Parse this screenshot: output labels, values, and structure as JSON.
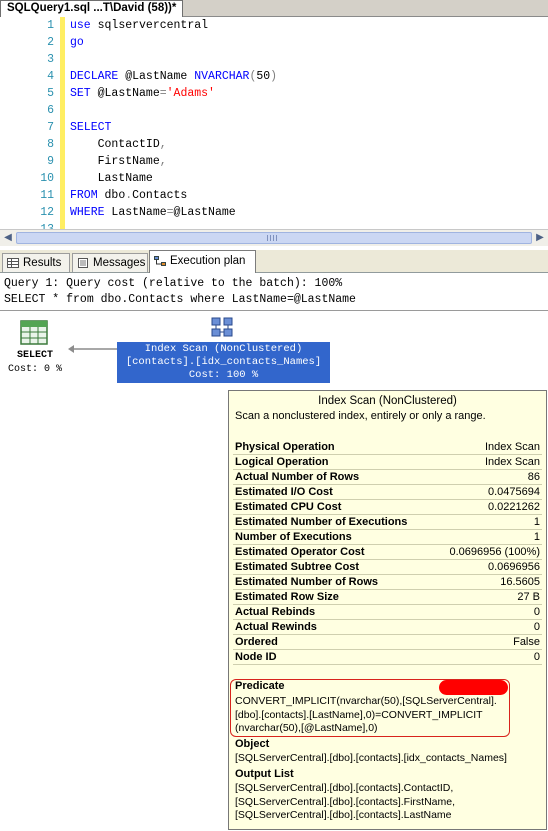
{
  "window": {
    "tab_title": "SQLQuery1.sql ...T\\David (58))*"
  },
  "editor": {
    "lines": [
      {
        "n": "1",
        "tokens": [
          {
            "t": "use",
            "c": "kw"
          },
          {
            "t": " sqlservercentral",
            "c": ""
          }
        ]
      },
      {
        "n": "2",
        "tokens": [
          {
            "t": "go",
            "c": "kw"
          }
        ]
      },
      {
        "n": "3",
        "tokens": []
      },
      {
        "n": "4",
        "tokens": [
          {
            "t": "DECLARE",
            "c": "kw"
          },
          {
            "t": " @LastName ",
            "c": ""
          },
          {
            "t": "NVARCHAR",
            "c": "kw"
          },
          {
            "t": "(",
            "c": "gr"
          },
          {
            "t": "50",
            "c": ""
          },
          {
            "t": ")",
            "c": "gr"
          }
        ]
      },
      {
        "n": "5",
        "tokens": [
          {
            "t": "SET",
            "c": "kw"
          },
          {
            "t": " @LastName",
            "c": ""
          },
          {
            "t": "=",
            "c": "gr"
          },
          {
            "t": "'Adams'",
            "c": "str"
          }
        ]
      },
      {
        "n": "6",
        "tokens": []
      },
      {
        "n": "7",
        "tokens": [
          {
            "t": "SELECT",
            "c": "kw"
          }
        ]
      },
      {
        "n": "8",
        "tokens": [
          {
            "t": "    ContactID",
            "c": ""
          },
          {
            "t": ",",
            "c": "gr"
          }
        ]
      },
      {
        "n": "9",
        "tokens": [
          {
            "t": "    FirstName",
            "c": ""
          },
          {
            "t": ",",
            "c": "gr"
          }
        ]
      },
      {
        "n": "10",
        "tokens": [
          {
            "t": "    LastName",
            "c": ""
          }
        ]
      },
      {
        "n": "11",
        "tokens": [
          {
            "t": "FROM",
            "c": "kw"
          },
          {
            "t": " dbo",
            "c": ""
          },
          {
            "t": ".",
            "c": "gr"
          },
          {
            "t": "Contacts",
            "c": ""
          }
        ]
      },
      {
        "n": "12",
        "tokens": [
          {
            "t": "WHERE",
            "c": "kw"
          },
          {
            "t": " LastName",
            "c": ""
          },
          {
            "t": "=",
            "c": "gr"
          },
          {
            "t": "@LastName",
            "c": ""
          }
        ]
      },
      {
        "n": "13",
        "tokens": []
      }
    ]
  },
  "result_tabs": [
    {
      "label": "Results",
      "active": false
    },
    {
      "label": "Messages",
      "active": false
    },
    {
      "label": "Execution plan",
      "active": true
    }
  ],
  "plan": {
    "query_cost": "Query 1: Query cost (relative to the batch): 100%",
    "query_text": "SELECT * from dbo.Contacts where LastName=@LastName",
    "select_op": {
      "name": "SELECT",
      "cost": "Cost: 0 %"
    },
    "scan_op": {
      "name": "Index Scan (NonClustered)",
      "object": "[contacts].[idx_contacts_Names]",
      "cost": "Cost: 100 %"
    }
  },
  "tooltip": {
    "title": "Index Scan (NonClustered)",
    "description": "Scan a nonclustered index, entirely or only a range.",
    "properties": [
      {
        "label": "Physical Operation",
        "value": "Index Scan"
      },
      {
        "label": "Logical Operation",
        "value": "Index Scan"
      },
      {
        "label": "Actual Number of Rows",
        "value": "86"
      },
      {
        "label": "Estimated I/O Cost",
        "value": "0.0475694"
      },
      {
        "label": "Estimated CPU Cost",
        "value": "0.0221262"
      },
      {
        "label": "Estimated Number of Executions",
        "value": "1"
      },
      {
        "label": "Number of Executions",
        "value": "1"
      },
      {
        "label": "Estimated Operator Cost",
        "value": "0.0696956 (100%)"
      },
      {
        "label": "Estimated Subtree Cost",
        "value": "0.0696956"
      },
      {
        "label": "Estimated Number of Rows",
        "value": "16.5605"
      },
      {
        "label": "Estimated Row Size",
        "value": "27 B"
      },
      {
        "label": "Actual Rebinds",
        "value": "0"
      },
      {
        "label": "Actual Rewinds",
        "value": "0"
      },
      {
        "label": "Ordered",
        "value": "False"
      },
      {
        "label": "Node ID",
        "value": "0"
      }
    ],
    "predicate": {
      "title": "Predicate",
      "lines": [
        "CONVERT_IMPLICIT(nvarchar(50),[SQLServerCentral].",
        "[dbo].[contacts].[LastName],0)=CONVERT_IMPLICIT",
        "(nvarchar(50),[@LastName],0)"
      ]
    },
    "object": {
      "title": "Object",
      "lines": [
        "[SQLServerCentral].[dbo].[contacts].[idx_contacts_Names]"
      ]
    },
    "output_list": {
      "title": "Output List",
      "lines": [
        "[SQLServerCentral].[dbo].[contacts].ContactID,",
        "[SQLServerCentral].[dbo].[contacts].FirstName,",
        "[SQLServerCentral].[dbo].[contacts].LastName"
      ]
    }
  },
  "colors": {
    "keyword": "#0000ff",
    "string": "#ff0000",
    "line_number": "#2b91af",
    "operator_highlight": "#3266cc",
    "tooltip_bg": "#ffffe1",
    "predicate_outline": "#d8231c"
  },
  "icons": {
    "select_op": "table-grid-icon",
    "scan_op": "index-scan-icon",
    "results_tab": "grid-icon",
    "messages_tab": "document-icon",
    "plan_tab": "execution-plan-icon"
  }
}
